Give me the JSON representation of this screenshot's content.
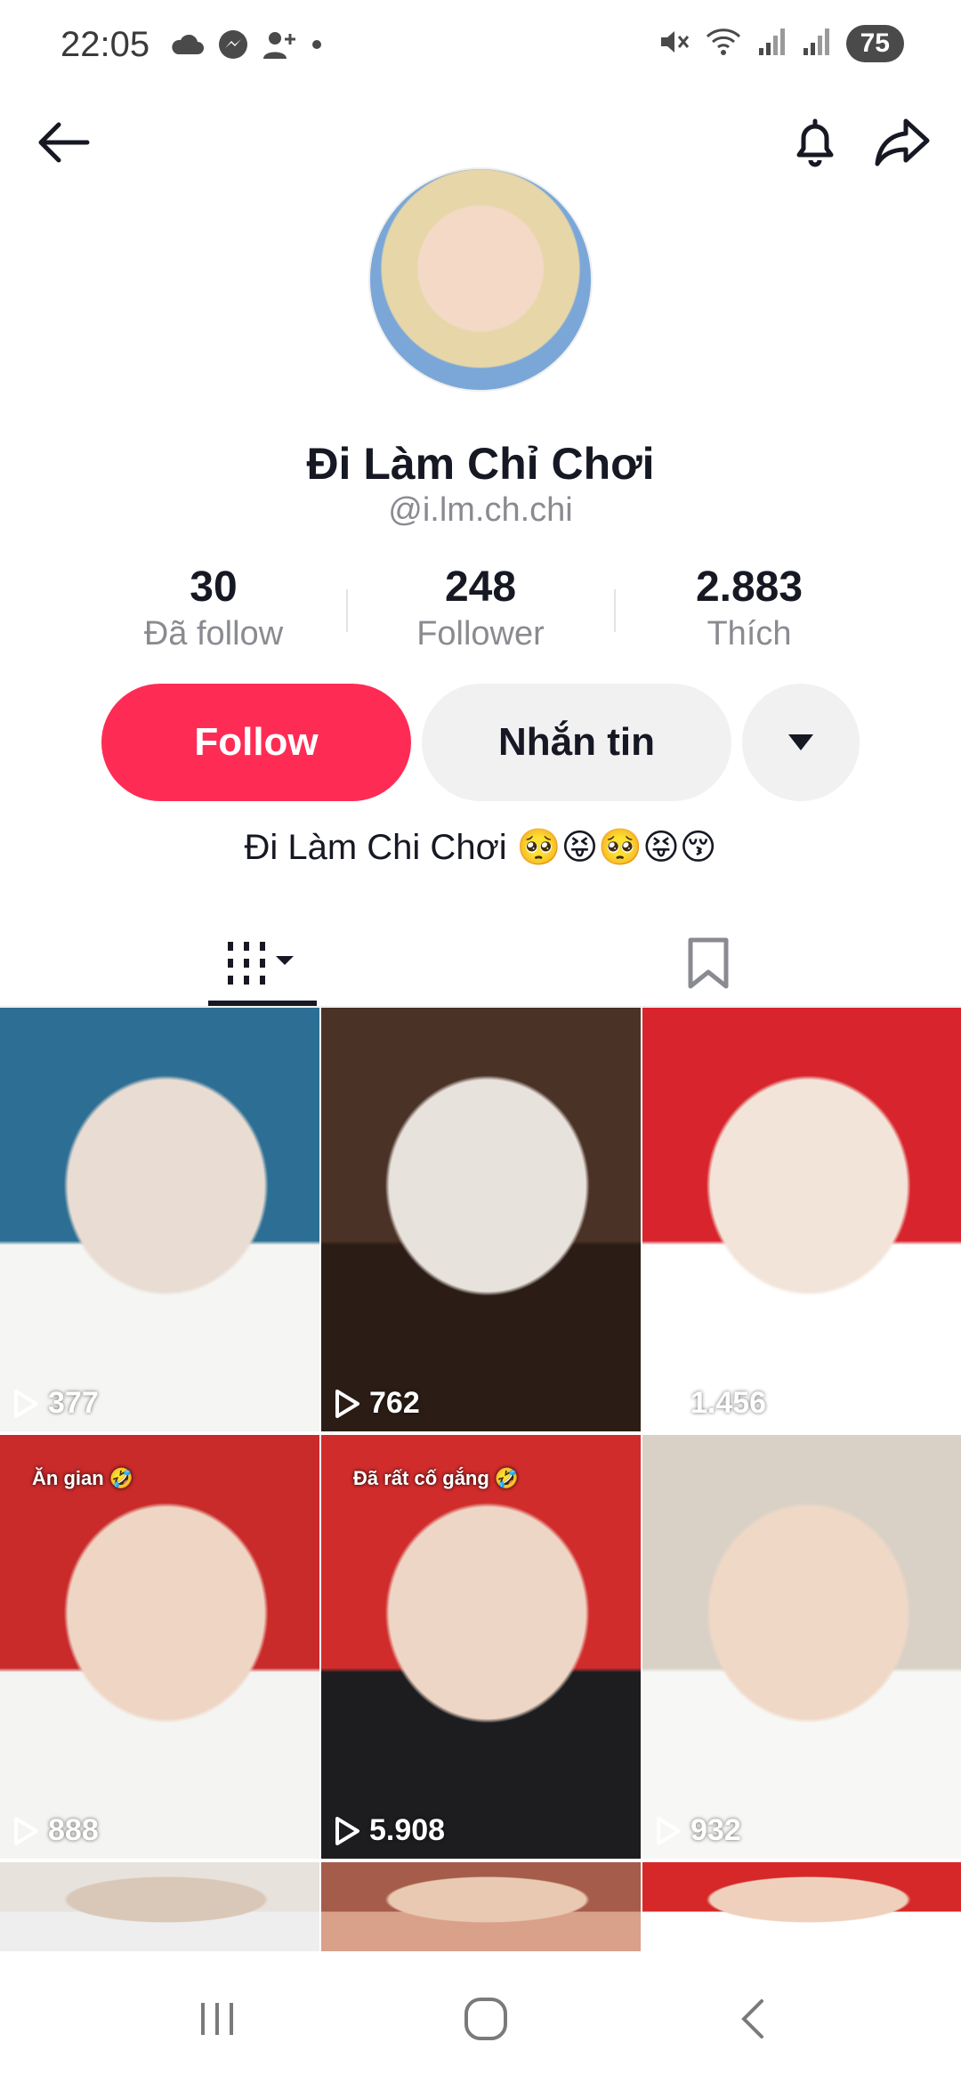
{
  "status_bar": {
    "time": "22:05",
    "left_icons": [
      "cloud-icon",
      "messenger-icon",
      "add-person-icon",
      "dot-icon"
    ],
    "right_icons": [
      "mute-icon",
      "wifi-icon",
      "signal-icon",
      "signal-icon"
    ],
    "battery": "75"
  },
  "header": {
    "back_icon": "back-arrow-icon",
    "bell_icon": "bell-icon",
    "share_icon": "share-icon"
  },
  "profile": {
    "display_name": "Đi Làm Chỉ Chơi",
    "username": "@i.lm.ch.chi",
    "bio": "Đi Làm Chi Chơi 🥺😝🥺😝😚"
  },
  "stats": [
    {
      "value": "30",
      "label": "Đã follow"
    },
    {
      "value": "248",
      "label": "Follower"
    },
    {
      "value": "2.883",
      "label": "Thích"
    }
  ],
  "actions": {
    "follow_label": "Follow",
    "message_label": "Nhắn tin",
    "follow_color": "#fe2c55"
  },
  "tabs": [
    {
      "icon": "grid-icon",
      "active": true
    },
    {
      "icon": "bookmark-icon",
      "active": false
    }
  ],
  "videos": [
    {
      "views": "377",
      "caption": "",
      "colors": [
        "#2d6f94",
        "#e9dcd2",
        "#f5f5f3"
      ]
    },
    {
      "views": "762",
      "caption": "",
      "colors": [
        "#4b3227",
        "#e8e2dc",
        "#2b1d15"
      ]
    },
    {
      "views": "1.456",
      "caption": "",
      "colors": [
        "#d8242d",
        "#f2e4d8",
        "#ffffff"
      ]
    },
    {
      "views": "888",
      "caption": "Ăn gian 🤣",
      "colors": [
        "#c92a2a",
        "#efd5c4",
        "#f4f4f2"
      ]
    },
    {
      "views": "5.908",
      "caption": "Đã rất cố gắng 🤣",
      "colors": [
        "#d12c2c",
        "#eed6c6",
        "#1d1d20"
      ]
    },
    {
      "views": "932",
      "caption": "",
      "colors": [
        "#d9d1c6",
        "#f0d8c6",
        "#f7f7f5"
      ]
    },
    {
      "views": "",
      "caption": "",
      "colors": [
        "#e7e2dc",
        "#d9c8b8",
        "#eeeeee"
      ]
    },
    {
      "views": "",
      "caption": "",
      "colors": [
        "#a65c4a",
        "#e9c9b2",
        "#d9a08a"
      ]
    },
    {
      "views": "",
      "caption": "",
      "colors": [
        "#d62828",
        "#efd0bd",
        "#ffffff"
      ]
    }
  ],
  "system_nav": [
    "recent-apps-icon",
    "home-icon",
    "back-icon"
  ]
}
